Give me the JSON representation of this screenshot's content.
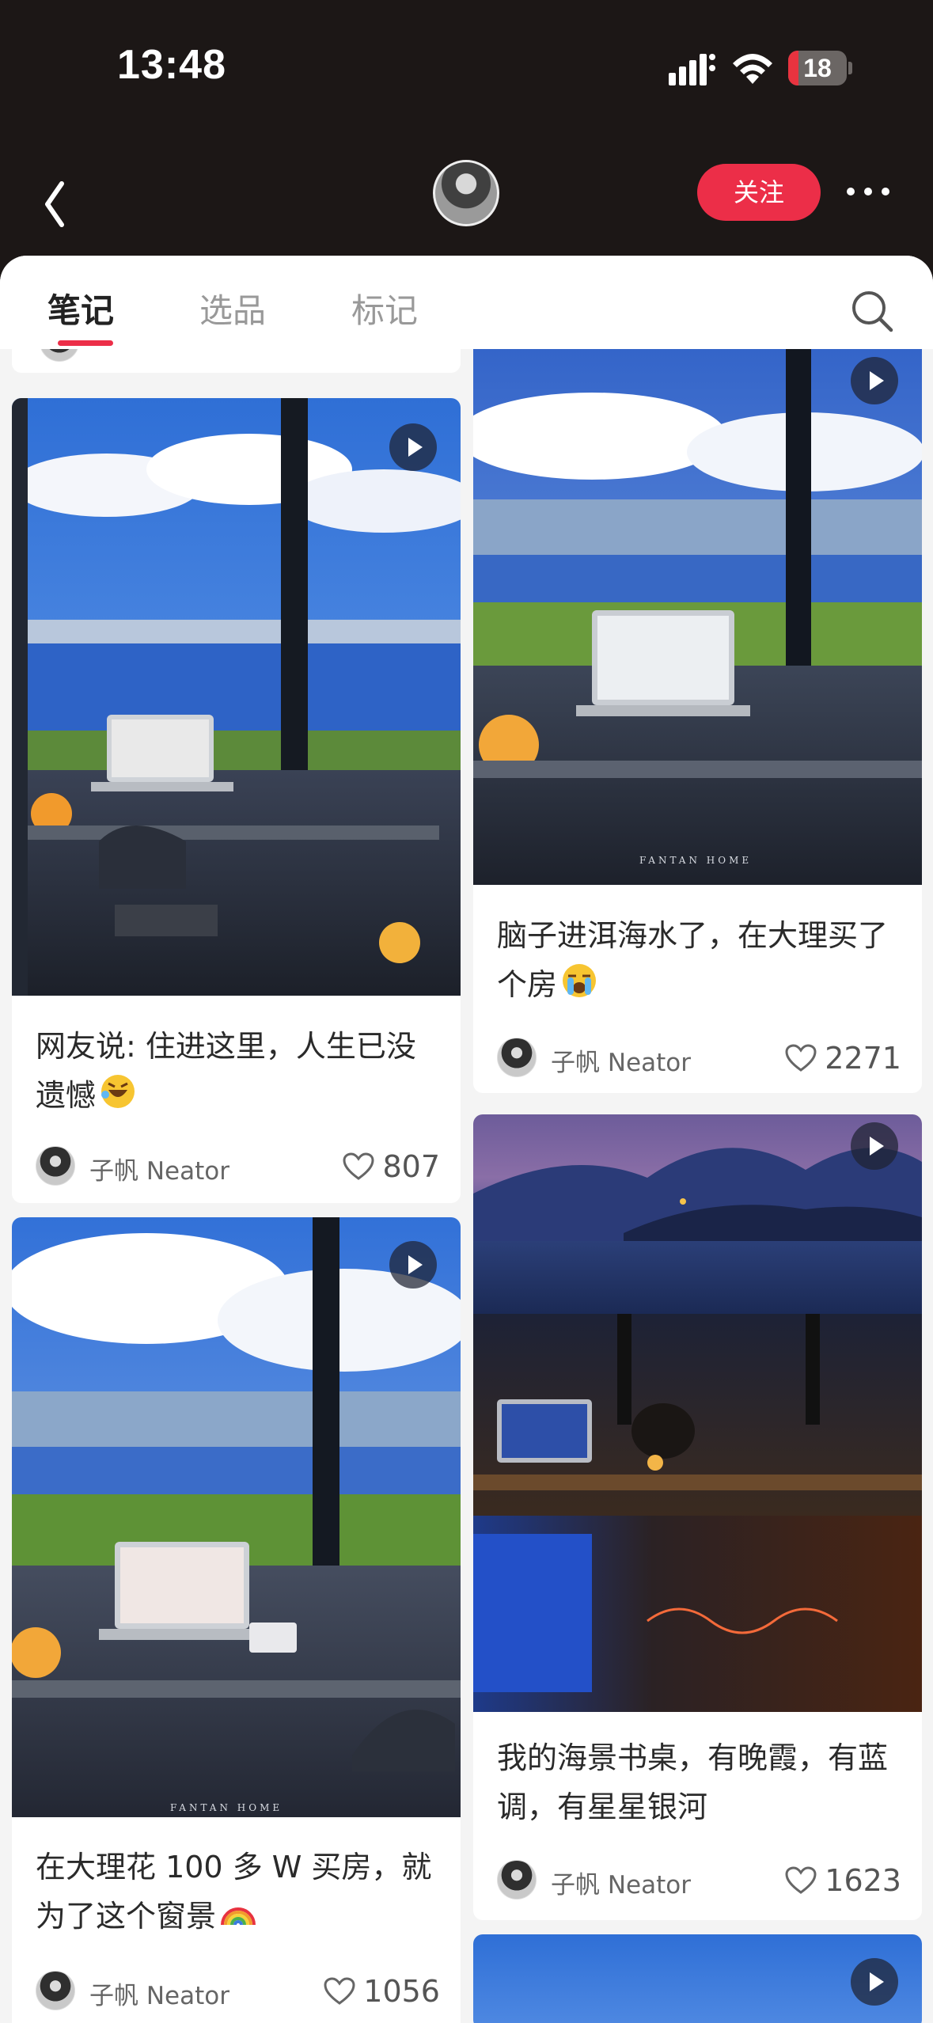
{
  "status_bar": {
    "time": "13:48",
    "battery_level": "18",
    "battery_fraction": 0.18
  },
  "header": {
    "follow_label": "关注"
  },
  "tabs": [
    {
      "label": "笔记",
      "active": true
    },
    {
      "label": "选品",
      "active": false
    },
    {
      "label": "标记",
      "active": false
    }
  ],
  "author_name": "子帆 Neator",
  "colors": {
    "accent": "#ec2e48",
    "background_dark": "#1c1716",
    "sheet": "#f4f4f4"
  },
  "icons": [
    "back-arrow-icon",
    "more-icon",
    "search-icon",
    "play-icon",
    "heart-icon"
  ],
  "notes": [
    {
      "title": "网友说: 住进这里，人生已没遗憾",
      "emoji": "rolling-on-floor-laughing",
      "author": "子帆 Neator",
      "likes": "807",
      "video": true
    },
    {
      "title": "脑子进洱海水了，在大理买了个房",
      "emoji": "loudly-crying-face",
      "author": "子帆 Neator",
      "likes": "2271",
      "video": true
    },
    {
      "title": "在大理花 100 多 W 买房，就为了这个窗景",
      "emoji": "rainbow",
      "author": "子帆 Neator",
      "likes": "1056",
      "video": true
    },
    {
      "title": "我的海景书桌，有晚霞，有蓝调，有星星银河",
      "emoji": "",
      "author": "子帆 Neator",
      "likes": "1623",
      "video": true
    }
  ]
}
